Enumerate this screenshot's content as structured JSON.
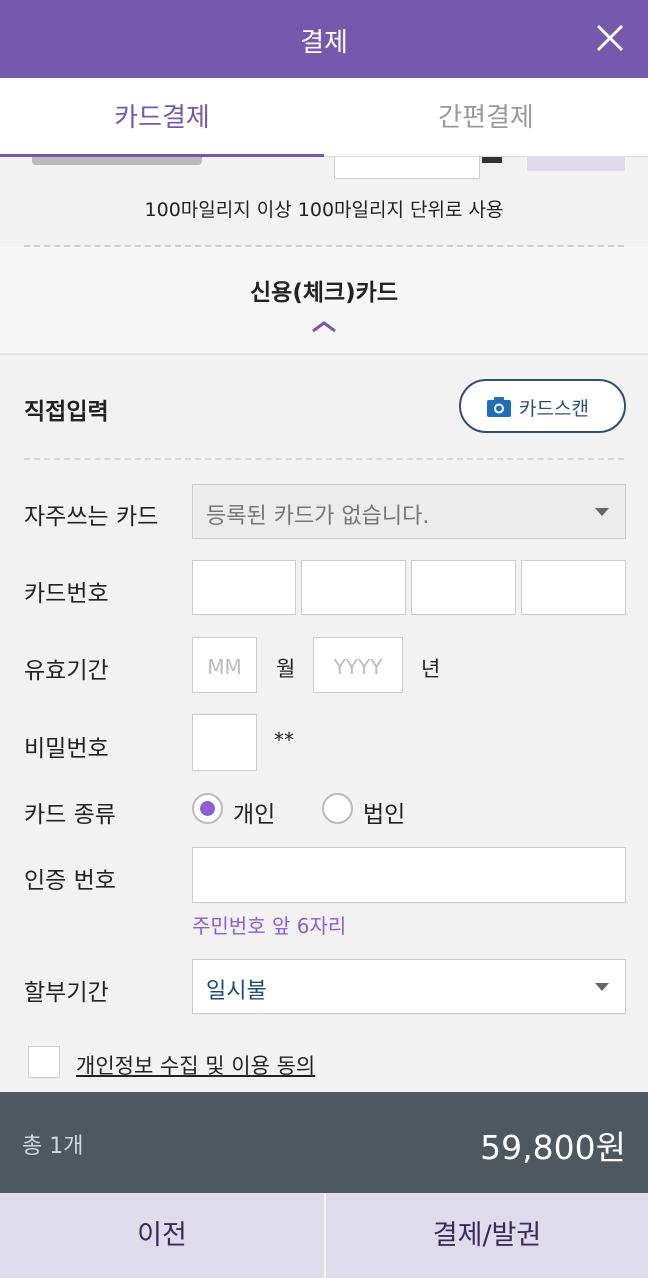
{
  "header": {
    "title": "결제",
    "close_icon": "close-icon"
  },
  "tabs": [
    {
      "label": "카드결제",
      "active": true
    },
    {
      "label": "간편결제",
      "active": false
    }
  ],
  "mileage": {
    "note": "100마일리지 이상 100마일리지 단위로 사용"
  },
  "card_section": {
    "title": "신용(체크)카드",
    "collapse_icon": "chevron-up-icon"
  },
  "direct_input": {
    "title": "직접입력",
    "scan_button": "카드스캔",
    "scan_icon": "camera-icon"
  },
  "form": {
    "favorite_card": {
      "label": "자주쓰는 카드",
      "value": "등록된 카드가 없습니다."
    },
    "card_number": {
      "label": "카드번호"
    },
    "expiry": {
      "label": "유효기간",
      "month_placeholder": "MM",
      "month_unit": "월",
      "year_placeholder": "YYYY",
      "year_unit": "년"
    },
    "password": {
      "label": "비밀번호",
      "mask": "**"
    },
    "card_type": {
      "label": "카드 종류",
      "options": [
        "개인",
        "법인"
      ],
      "selected": "개인"
    },
    "auth_number": {
      "label": "인증 번호",
      "helper": "주민번호 앞 6자리"
    },
    "installment": {
      "label": "할부기간",
      "value": "일시불"
    },
    "consent": {
      "label": "개인정보 수집 및 이용 동의",
      "checked": false
    }
  },
  "total": {
    "count": "총 1개",
    "amount": "59,800원"
  },
  "buttons": {
    "prev": "이전",
    "pay": "결제/발권"
  },
  "colors": {
    "brand": "#7658ad",
    "accent": "#8c5fd6",
    "total_bar": "#4d5860",
    "button_bg": "#dedbea"
  }
}
